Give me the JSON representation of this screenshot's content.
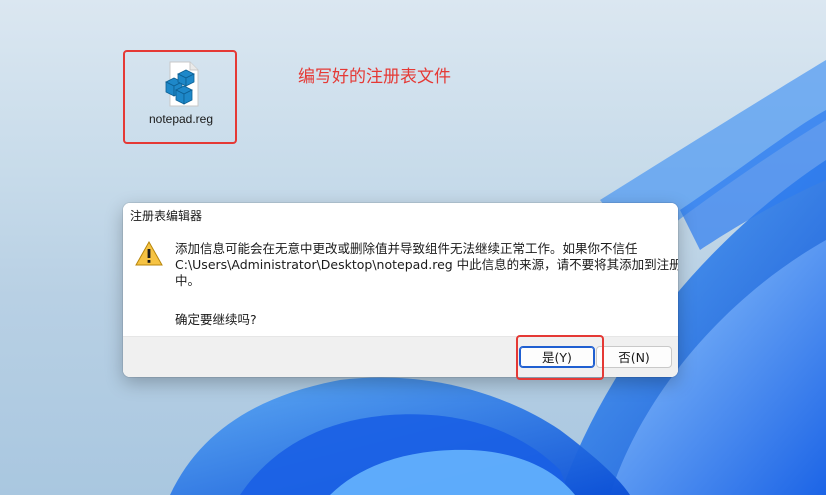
{
  "desktop": {
    "file_icon_label": "notepad.reg",
    "annotation_text": "编写好的注册表文件",
    "highlight_color": "#e53935"
  },
  "dialog": {
    "title": "注册表编辑器",
    "icon": "warning-icon",
    "message_lines": [
      "添加信息可能会在无意中更改或删除值并导致组件无法继续正常工作。如果你不信任",
      "C:\\Users\\Administrator\\Desktop\\notepad.reg 中此信息的来源，请不要将其添加到注册表",
      "中。"
    ],
    "question": "确定要继续吗?",
    "buttons": {
      "yes_label": "是(Y)",
      "no_label": "否(N)"
    },
    "accent_color": "#1f5fd1"
  }
}
